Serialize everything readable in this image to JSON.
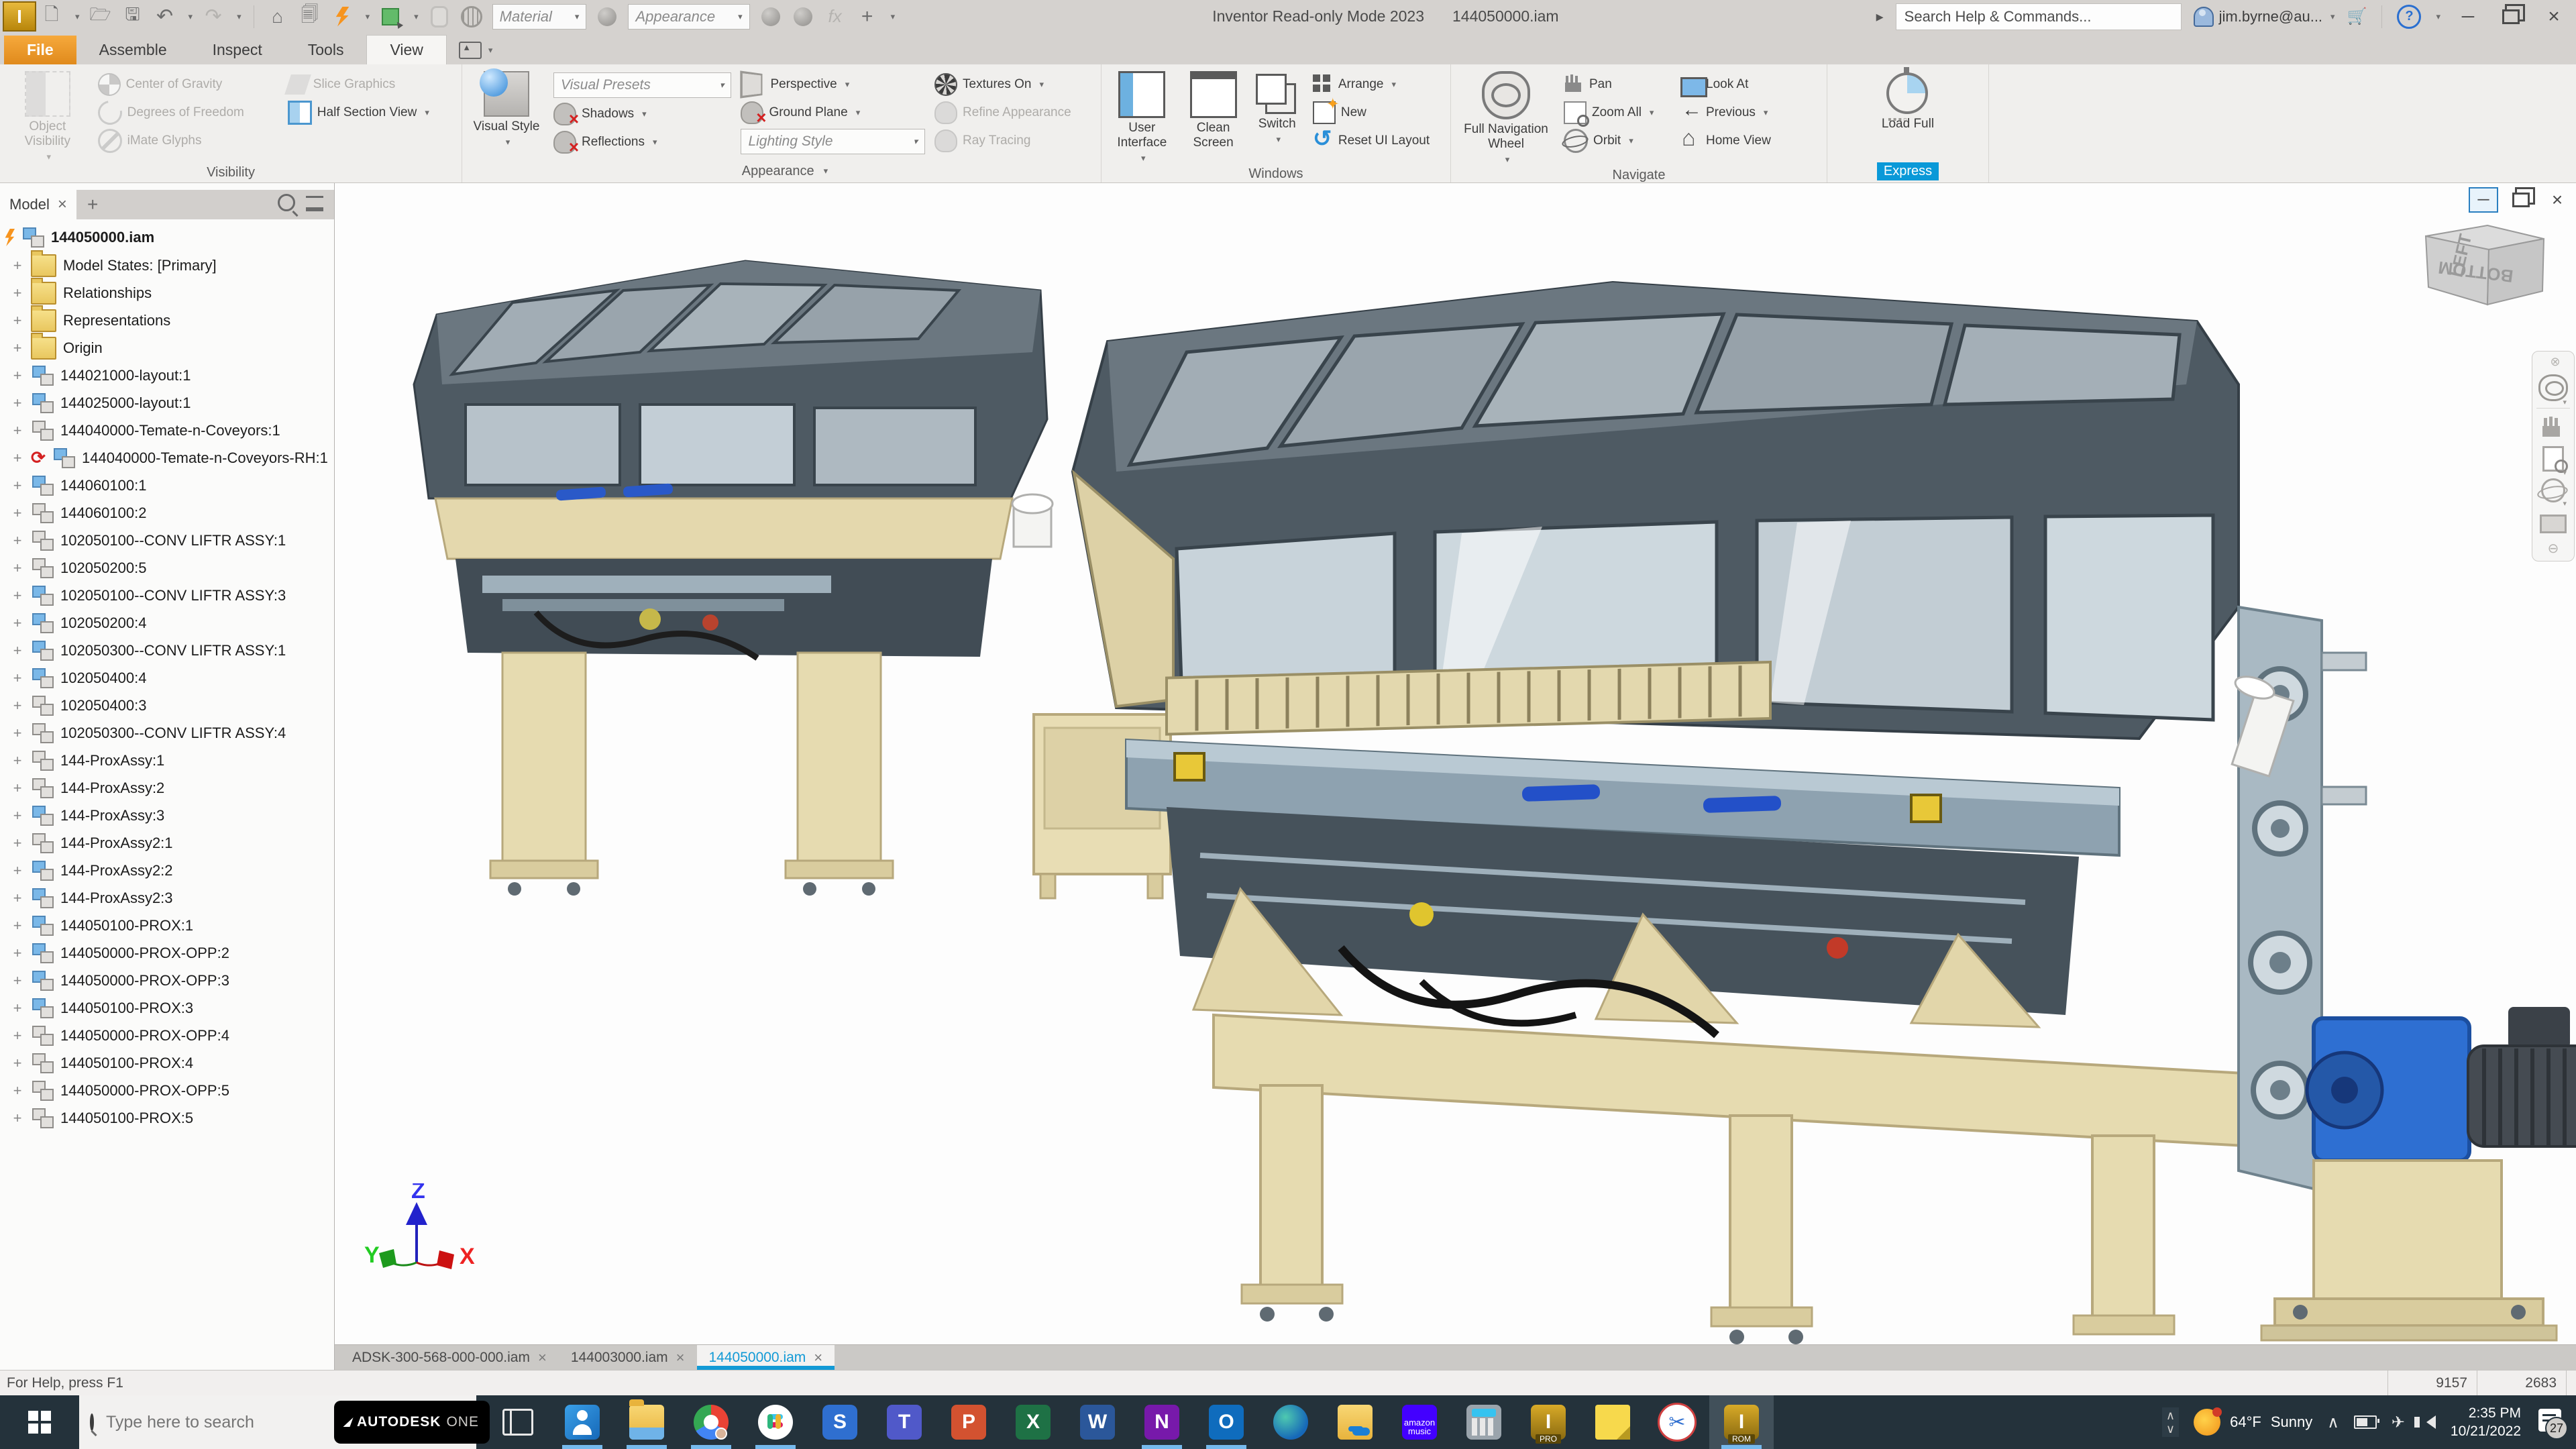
{
  "title_bar": {
    "app_title": "Inventor Read-only Mode 2023",
    "doc_title": "144050000.iam",
    "material_dropdown": "Material",
    "appearance_dropdown": "Appearance",
    "help_search_placeholder": "Search Help & Commands...",
    "user_email": "jim.byrne@au..."
  },
  "ribbon": {
    "tabs": [
      {
        "label": "File",
        "state": "file"
      },
      {
        "label": "Assemble",
        "state": ""
      },
      {
        "label": "Inspect",
        "state": ""
      },
      {
        "label": "Tools",
        "state": ""
      },
      {
        "label": "View",
        "state": "active"
      }
    ],
    "visibility": {
      "title": "Visibility",
      "object_visibility": "Object Visibility",
      "center_of_gravity": "Center of Gravity",
      "degrees_of_freedom": "Degrees of Freedom",
      "imate_glyphs": "iMate Glyphs",
      "slice_graphics": "Slice Graphics",
      "half_section_view": "Half Section View"
    },
    "appearance": {
      "title": "Appearance",
      "visual_style": "Visual Style",
      "visual_presets": "Visual Presets",
      "shadows": "Shadows",
      "reflections": "Reflections",
      "perspective": "Perspective",
      "ground_plane": "Ground Plane",
      "lighting_style": "Lighting Style",
      "textures_on": "Textures On",
      "refine_appearance": "Refine Appearance",
      "ray_tracing": "Ray Tracing"
    },
    "windows": {
      "title": "Windows",
      "user_interface": "User Interface",
      "clean_screen": "Clean Screen",
      "switch": "Switch",
      "arrange": "Arrange",
      "new": "New",
      "reset_ui_layout": "Reset UI Layout"
    },
    "navigate": {
      "title": "Navigate",
      "full_navigation_wheel": "Full Navigation Wheel",
      "pan": "Pan",
      "zoom_all": "Zoom All",
      "orbit": "Orbit",
      "look_at": "Look At",
      "previous": "Previous",
      "home_view": "Home View"
    },
    "express": {
      "title": "Express",
      "load_full": "Load Full"
    }
  },
  "browser": {
    "tab_label": "Model",
    "root_label": "144050000.iam",
    "items": [
      {
        "label": "Model States: [Primary]",
        "icon": "folder"
      },
      {
        "label": "Relationships",
        "icon": "folder"
      },
      {
        "label": "Representations",
        "icon": "folder"
      },
      {
        "label": "Origin",
        "icon": "folder"
      },
      {
        "label": "144021000-layout:1",
        "icon": "comp-blue"
      },
      {
        "label": "144025000-layout:1",
        "icon": "comp-blue"
      },
      {
        "label": "144040000-Temate-n-Coveyors:1",
        "icon": "comp-gray"
      },
      {
        "label": "144040000-Temate-n-Coveyors-RH:1",
        "icon": "comp-refresh"
      },
      {
        "label": "144060100:1",
        "icon": "comp-blue"
      },
      {
        "label": "144060100:2",
        "icon": "comp-gray"
      },
      {
        "label": "102050100--CONV LIFTR ASSY:1",
        "icon": "comp-gray"
      },
      {
        "label": "102050200:5",
        "icon": "comp-gray"
      },
      {
        "label": "102050100--CONV LIFTR ASSY:3",
        "icon": "comp-blue"
      },
      {
        "label": "102050200:4",
        "icon": "comp-blue"
      },
      {
        "label": "102050300--CONV LIFTR ASSY:1",
        "icon": "comp-blue"
      },
      {
        "label": "102050400:4",
        "icon": "comp-blue"
      },
      {
        "label": "102050400:3",
        "icon": "comp-gray"
      },
      {
        "label": "102050300--CONV LIFTR ASSY:4",
        "icon": "comp-gray"
      },
      {
        "label": "144-ProxAssy:1",
        "icon": "comp-gray"
      },
      {
        "label": "144-ProxAssy:2",
        "icon": "comp-gray"
      },
      {
        "label": "144-ProxAssy:3",
        "icon": "comp-blue"
      },
      {
        "label": "144-ProxAssy2:1",
        "icon": "comp-gray"
      },
      {
        "label": "144-ProxAssy2:2",
        "icon": "comp-blue"
      },
      {
        "label": "144-ProxAssy2:3",
        "icon": "comp-blue"
      },
      {
        "label": "144050100-PROX:1",
        "icon": "comp-blue"
      },
      {
        "label": "144050000-PROX-OPP:2",
        "icon": "comp-blue"
      },
      {
        "label": "144050000-PROX-OPP:3",
        "icon": "comp-blue"
      },
      {
        "label": "144050100-PROX:3",
        "icon": "comp-blue"
      },
      {
        "label": "144050000-PROX-OPP:4",
        "icon": "comp-gray"
      },
      {
        "label": "144050100-PROX:4",
        "icon": "comp-gray"
      },
      {
        "label": "144050000-PROX-OPP:5",
        "icon": "comp-gray"
      },
      {
        "label": "144050100-PROX:5",
        "icon": "comp-gray"
      }
    ]
  },
  "viewport": {
    "viewcube_left_face": "LEFT",
    "viewcube_bottom_face": "BOTTOM",
    "triad_x": "X",
    "triad_y": "Y",
    "triad_z": "Z"
  },
  "doc_tabs": [
    {
      "label": "ADSK-300-568-000-000.iam",
      "state": ""
    },
    {
      "label": "144003000.iam",
      "state": ""
    },
    {
      "label": "144050000.iam",
      "state": "active"
    }
  ],
  "status_bar": {
    "help_text": "For Help, press F1",
    "count_1": "9157",
    "count_2": "2683"
  },
  "taskbar": {
    "search_placeholder": "Type here to search",
    "autodesk_badge": "AUTODESK",
    "autodesk_badge_suffix": "ONE",
    "icons": [
      {
        "name": "task-view-button",
        "kind": "kind-taskview",
        "state": "",
        "glyph": "",
        "sub": ""
      },
      {
        "name": "people-app",
        "kind": "kind-people",
        "state": "running",
        "glyph": "",
        "sub": ""
      },
      {
        "name": "file-explorer-app",
        "kind": "kind-explorer",
        "state": "running",
        "glyph": "",
        "sub": ""
      },
      {
        "name": "chrome-app",
        "kind": "kind-chrome",
        "state": "running",
        "glyph": "",
        "sub": ""
      },
      {
        "name": "slack-app",
        "kind": "kind-slack",
        "state": "running",
        "glyph": "",
        "sub": ""
      },
      {
        "name": "snagit-app",
        "kind": "kind-snagit",
        "state": "",
        "glyph": "S",
        "sub": ""
      },
      {
        "name": "teams-app",
        "kind": "kind-teams",
        "state": "",
        "glyph": "T",
        "sub": ""
      },
      {
        "name": "powerpoint-app",
        "kind": "kind-ppt",
        "state": "",
        "glyph": "P",
        "sub": ""
      },
      {
        "name": "excel-app",
        "kind": "kind-excel",
        "state": "",
        "glyph": "X",
        "sub": ""
      },
      {
        "name": "word-app",
        "kind": "kind-word",
        "state": "",
        "glyph": "W",
        "sub": ""
      },
      {
        "name": "onenote-app",
        "kind": "kind-onenote",
        "state": "running",
        "glyph": "N",
        "sub": ""
      },
      {
        "name": "outlook-app",
        "kind": "kind-outlook",
        "state": "running",
        "glyph": "O",
        "sub": ""
      },
      {
        "name": "edge-app",
        "kind": "kind-edge",
        "state": "",
        "glyph": "",
        "sub": ""
      },
      {
        "name": "onedrive-app",
        "kind": "kind-onedrive",
        "state": "",
        "glyph": "",
        "sub": ""
      },
      {
        "name": "amazon-music-app",
        "kind": "kind-amazonmusic",
        "state": "",
        "glyph": "amazon",
        "sub": "music"
      },
      {
        "name": "calculator-app",
        "kind": "kind-calculator",
        "state": "",
        "glyph": "",
        "sub": ""
      },
      {
        "name": "inventor-pro-app",
        "kind": "kind-inventorpro",
        "state": "",
        "glyph": "I",
        "sub": "PRO"
      },
      {
        "name": "sticky-notes-app",
        "kind": "kind-sticky",
        "state": "",
        "glyph": "",
        "sub": ""
      },
      {
        "name": "snipping-tool-app",
        "kind": "kind-snip",
        "state": "",
        "glyph": "✂",
        "sub": ""
      },
      {
        "name": "inventor-rom-app",
        "kind": "kind-inventorrom",
        "state": "running active",
        "glyph": "I",
        "sub": "ROM"
      }
    ],
    "tray": {
      "weather_temp": "64°F",
      "weather_desc": "Sunny",
      "time": "2:35 PM",
      "date": "10/21/2022",
      "notification_count": "27"
    }
  }
}
